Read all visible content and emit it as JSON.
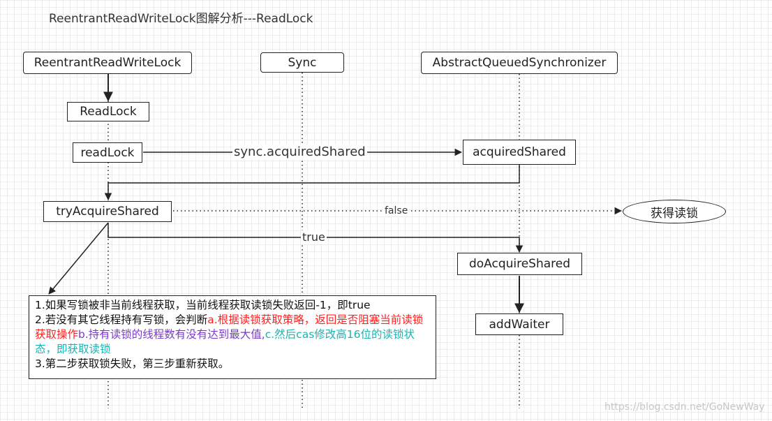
{
  "title": "ReentrantReadWriteLock图解分析---ReadLock",
  "lanes": {
    "rrwl": "ReentrantReadWriteLock",
    "sync": "Sync",
    "aqs": "AbstractQueuedSynchronizer"
  },
  "nodes": {
    "readLock_class": "ReadLock",
    "readLock_method": "readLock",
    "acquiredShared": "acquiredShared",
    "tryAcquireShared": "tryAcquireShared",
    "getReadLock": "获得读锁",
    "doAcquireShared": "doAcquireShared",
    "addWaiter": "addWaiter"
  },
  "edges": {
    "call": "sync.acquiredShared",
    "false": "false",
    "true": "true"
  },
  "note": {
    "line1": "1.如果写锁被非当前线程获取，当前线程获取读锁失败返回-1，即true",
    "line2_prefix": "2.若没有其它线程持有写锁，会判断",
    "line2_a": "a.根据读锁获取策略，返回是否阻塞当前读锁获取操作",
    "line2_b": "b.持有读锁的线程数有没有达到最大值,",
    "line2_c": "c.然后cas修改高16位的读锁状态，即获取读锁",
    "line3": "3.第二步获取锁失败，第三步重新获取。"
  },
  "colors": {
    "red": "#ff1f1f",
    "purple": "#7a3cc8",
    "teal": "#1ab3b3"
  },
  "watermark": "https://blog.csdn.net/GoNewWay"
}
